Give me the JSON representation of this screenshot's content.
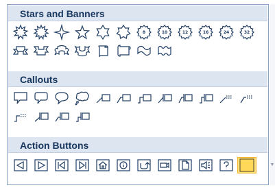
{
  "sections": [
    {
      "title": "Stars and Banners",
      "rows": [
        [
          {
            "name": "explosion-1-icon",
            "kind": "explosion"
          },
          {
            "name": "explosion-2-icon",
            "kind": "explosion2"
          },
          {
            "name": "4-point-star-icon",
            "kind": "star4"
          },
          {
            "name": "5-point-star-icon",
            "kind": "star5"
          },
          {
            "name": "6-point-star-icon",
            "kind": "star6"
          },
          {
            "name": "7-point-star-icon",
            "kind": "star7"
          },
          {
            "name": "8-point-star-icon",
            "kind": "badge",
            "label": "8"
          },
          {
            "name": "10-point-star-icon",
            "kind": "badge",
            "label": "10"
          },
          {
            "name": "12-point-star-icon",
            "kind": "badge",
            "label": "12"
          },
          {
            "name": "16-point-star-icon",
            "kind": "badge",
            "label": "16"
          },
          {
            "name": "24-point-star-icon",
            "kind": "badge",
            "label": "24"
          },
          {
            "name": "32-point-star-icon",
            "kind": "badge",
            "label": "32"
          }
        ],
        [
          {
            "name": "up-ribbon-icon",
            "kind": "ribbon"
          },
          {
            "name": "down-ribbon-icon",
            "kind": "ribbon2"
          },
          {
            "name": "curved-up-ribbon-icon",
            "kind": "ribbon3"
          },
          {
            "name": "curved-down-ribbon-icon",
            "kind": "ribbon4"
          },
          {
            "name": "vertical-scroll-icon",
            "kind": "vscroll"
          },
          {
            "name": "horizontal-scroll-icon",
            "kind": "hscroll"
          },
          {
            "name": "wave-icon",
            "kind": "wave"
          },
          {
            "name": "double-wave-icon",
            "kind": "dwave"
          }
        ]
      ]
    },
    {
      "title": "Callouts",
      "rows": [
        [
          {
            "name": "rectangular-callout-icon",
            "kind": "callout-rect"
          },
          {
            "name": "rounded-rectangular-callout-icon",
            "kind": "callout-round"
          },
          {
            "name": "oval-callout-icon",
            "kind": "callout-oval"
          },
          {
            "name": "cloud-callout-icon",
            "kind": "callout-cloud"
          },
          {
            "name": "line-callout-1-icon",
            "kind": "line1"
          },
          {
            "name": "line-callout-2-icon",
            "kind": "line2"
          },
          {
            "name": "line-callout-3-icon",
            "kind": "line3"
          },
          {
            "name": "line-callout-1-accent-bar-icon",
            "kind": "line1a"
          },
          {
            "name": "line-callout-2-accent-bar-icon",
            "kind": "line2a"
          },
          {
            "name": "line-callout-3-accent-bar-icon",
            "kind": "line3a"
          },
          {
            "name": "line-callout-1-no-border-icon",
            "kind": "line1n"
          },
          {
            "name": "line-callout-2-no-border-icon",
            "kind": "line2n"
          }
        ],
        [
          {
            "name": "line-callout-3-no-border-icon",
            "kind": "line3n"
          },
          {
            "name": "line-callout-1-border-and-accent-bar-icon",
            "kind": "line1b"
          },
          {
            "name": "line-callout-2-border-and-accent-bar-icon",
            "kind": "line2b"
          },
          {
            "name": "line-callout-3-border-and-accent-bar-icon",
            "kind": "line3b"
          }
        ]
      ]
    },
    {
      "title": "Action Buttons",
      "rows": [
        [
          {
            "name": "action-back-icon",
            "kind": "ab-back"
          },
          {
            "name": "action-forward-icon",
            "kind": "ab-forward"
          },
          {
            "name": "action-beginning-icon",
            "kind": "ab-begin"
          },
          {
            "name": "action-end-icon",
            "kind": "ab-end"
          },
          {
            "name": "action-home-icon",
            "kind": "ab-home"
          },
          {
            "name": "action-information-icon",
            "kind": "ab-info"
          },
          {
            "name": "action-return-icon",
            "kind": "ab-return"
          },
          {
            "name": "action-movie-icon",
            "kind": "ab-movie"
          },
          {
            "name": "action-document-icon",
            "kind": "ab-doc"
          },
          {
            "name": "action-sound-icon",
            "kind": "ab-sound"
          },
          {
            "name": "action-help-icon",
            "kind": "ab-help"
          },
          {
            "name": "action-custom-icon",
            "kind": "ab-custom",
            "selected": true
          }
        ]
      ]
    }
  ]
}
